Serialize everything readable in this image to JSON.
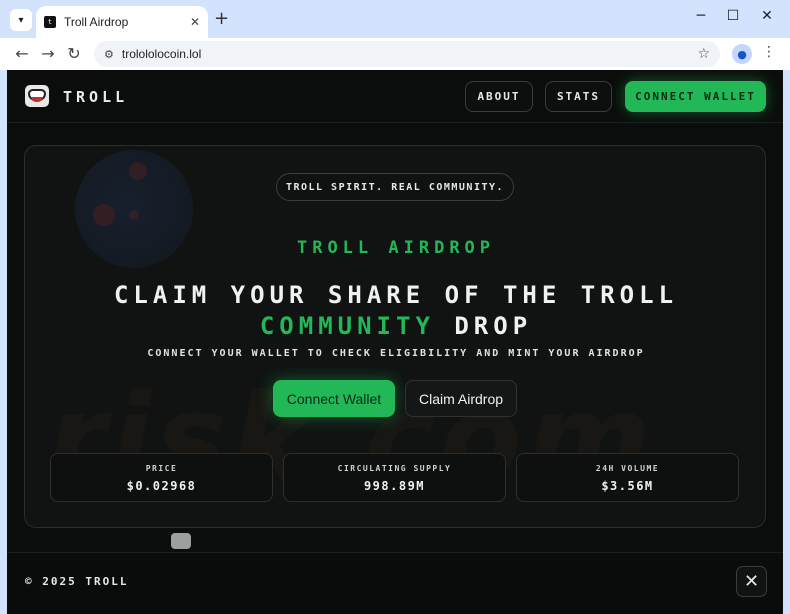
{
  "browser": {
    "tab_list_icon": "chevron-down",
    "tab_title": "Troll Airdrop",
    "tab_close": "✕",
    "new_tab": "+",
    "minimize": "─",
    "maximize": "☐",
    "close": "✕",
    "back": "←",
    "forward": "→",
    "reload": "↻",
    "url": "trolololocoin.lol",
    "bookmark_star": "☆",
    "menu": "⋮"
  },
  "site": {
    "brand": "TROLL",
    "nav": {
      "about": "ABOUT",
      "stats": "STATS",
      "connect_wallet": "CONNECT WALLET"
    },
    "hero": {
      "pill": "TROLL SPIRIT. REAL COMMUNITY.",
      "kicker": "TROLL AIRDROP",
      "headline_line1": "CLAIM YOUR SHARE OF THE TROLL",
      "headline_accent": "COMMUNITY",
      "headline_end": "DROP",
      "subline": "CONNECT YOUR WALLET TO CHECK ELIGIBILITY AND MINT YOUR AIRDROP",
      "connect_button": "Connect Wallet",
      "claim_button": "Claim Airdrop"
    },
    "stats": [
      {
        "label": "PRICE",
        "value": "$0.02968"
      },
      {
        "label": "CIRCULATING SUPPLY",
        "value": "998.89M"
      },
      {
        "label": "24H VOLUME",
        "value": "$3.56M"
      }
    ],
    "footer": {
      "copyright": "© 2025 TROLL",
      "close_icon": "✕"
    }
  },
  "colors": {
    "accent_green": "#22b857",
    "page_bg": "#0b0d0c",
    "browser_chrome": "#d3e3fd"
  }
}
